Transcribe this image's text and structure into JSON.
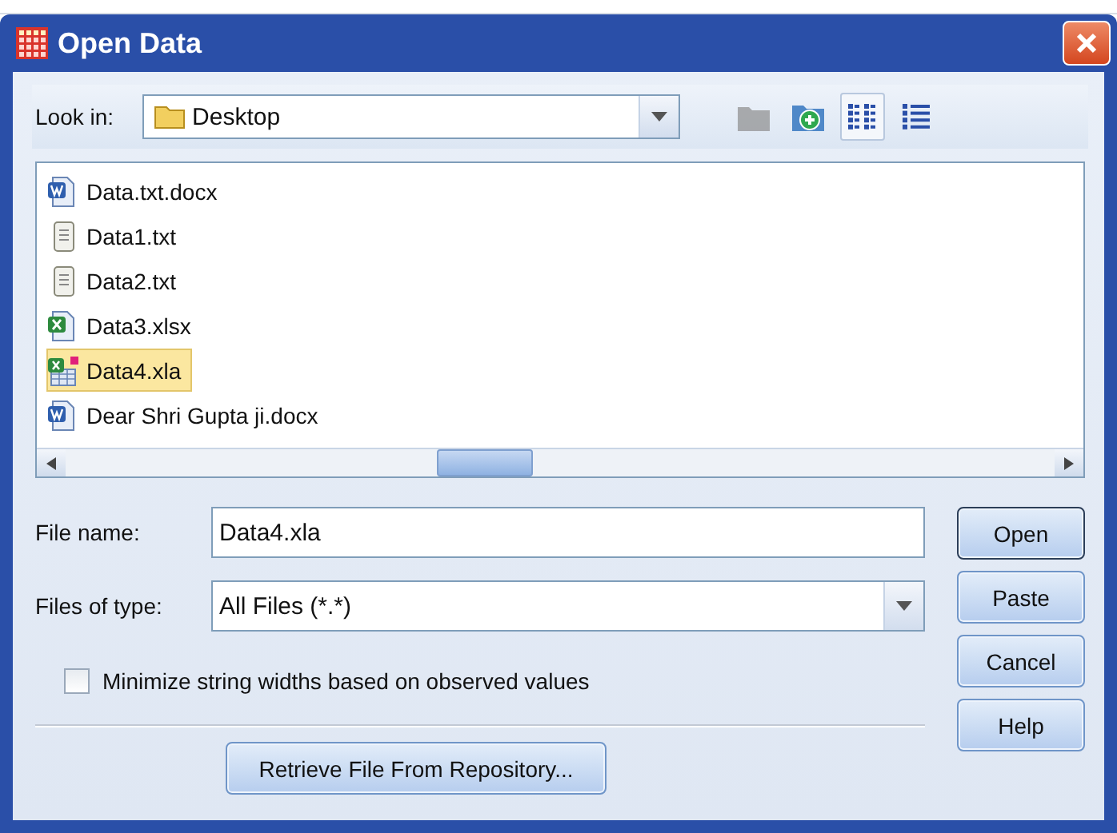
{
  "window": {
    "title": "Open Data"
  },
  "look_in": {
    "label": "Look in:",
    "value": "Desktop"
  },
  "toolbar": [
    {
      "kind": "up-folder",
      "disabled": true,
      "selected": false
    },
    {
      "kind": "new-folder",
      "disabled": false,
      "selected": false
    },
    {
      "kind": "list-view",
      "disabled": false,
      "selected": true
    },
    {
      "kind": "details-view",
      "disabled": false,
      "selected": false
    }
  ],
  "files": [
    {
      "name": "Data.txt.docx",
      "kind": "word",
      "selected": false
    },
    {
      "name": "Data1.txt",
      "kind": "text",
      "selected": false
    },
    {
      "name": "Data2.txt",
      "kind": "text",
      "selected": false
    },
    {
      "name": "Data3.xlsx",
      "kind": "excel",
      "selected": false
    },
    {
      "name": "Data4.xla",
      "kind": "addin",
      "selected": true
    },
    {
      "name": "Dear Shri Gupta ji.docx",
      "kind": "word",
      "selected": false
    }
  ],
  "file_name": {
    "label": "File name:",
    "value": "Data4.xla"
  },
  "files_of_type": {
    "label": "Files of type:",
    "value": "All Files (*.*)"
  },
  "minimize_option": {
    "label": "Minimize string widths based on observed values",
    "checked": false
  },
  "retrieve_button": "Retrieve File From Repository...",
  "buttons": [
    {
      "label": "Open",
      "default": true
    },
    {
      "label": "Paste",
      "default": false
    },
    {
      "label": "Cancel",
      "default": false
    },
    {
      "label": "Help",
      "default": false
    }
  ]
}
